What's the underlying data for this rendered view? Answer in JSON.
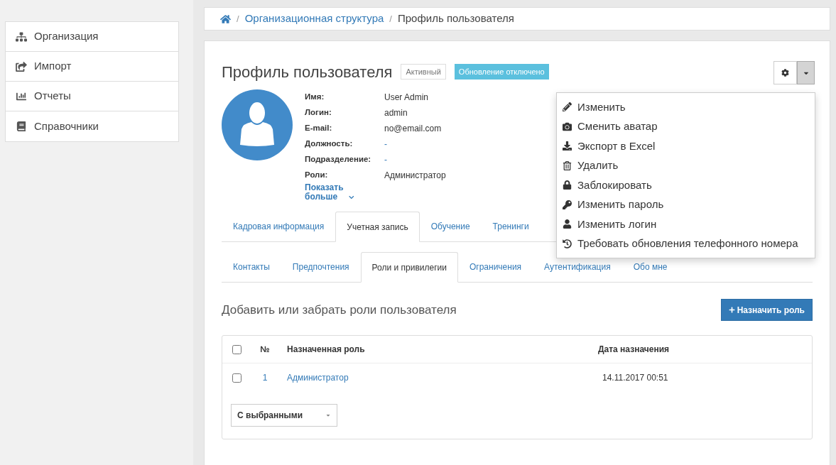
{
  "sidebar": {
    "items": [
      {
        "label": "Организация",
        "kind": "org"
      },
      {
        "label": "Импорт",
        "kind": "import"
      },
      {
        "label": "Отчеты",
        "kind": "reports"
      },
      {
        "label": "Справочники",
        "kind": "book"
      }
    ]
  },
  "breadcrumb": [
    {
      "label": "Организационная структура",
      "kind": "link",
      "separator": "/"
    },
    {
      "label": "Профиль пользователя",
      "kind": "current",
      "separator": "/"
    }
  ],
  "profile": {
    "title": "Профиль пользователя",
    "badges": [
      {
        "label": "Активный",
        "kind": "outline"
      },
      {
        "label": "Обновление отключено",
        "kind": "info"
      }
    ],
    "fields": [
      {
        "label": "Имя:",
        "value": "User Admin",
        "kind": "text"
      },
      {
        "label": "Логин:",
        "value": "admin",
        "kind": "text"
      },
      {
        "label": "E-mail:",
        "value": "no@email.com",
        "kind": "text"
      },
      {
        "label": "Должность:",
        "value": "-",
        "kind": "link"
      },
      {
        "label": "Подразделение:",
        "value": "-",
        "kind": "link"
      },
      {
        "label": "Роли:",
        "value": "Администратор",
        "kind": "text"
      }
    ],
    "show_more": "Показать больше"
  },
  "settings_menu": {
    "expanded": true,
    "items": [
      {
        "label": "Изменить",
        "kind": "edit"
      },
      {
        "label": "Сменить аватар",
        "kind": "camera"
      },
      {
        "label": "Экспорт в Excel",
        "kind": "download"
      },
      {
        "label": "Удалить",
        "kind": "trash"
      },
      {
        "label": "Заблокировать",
        "kind": "lock"
      },
      {
        "label": "Изменить пароль",
        "kind": "key"
      },
      {
        "label": "Изменить логин",
        "kind": "user"
      },
      {
        "label": "Требовать обновления телефонного номера",
        "kind": "history"
      }
    ]
  },
  "tabs": [
    {
      "label": "Кадровая информация",
      "selected": false
    },
    {
      "label": "Учетная запись",
      "selected": true
    },
    {
      "label": "Обучение",
      "selected": false
    },
    {
      "label": "Тренинги",
      "selected": false
    }
  ],
  "subtabs": [
    {
      "label": "Контакты",
      "selected": false
    },
    {
      "label": "Предпочтения",
      "selected": false
    },
    {
      "label": "Роли и привилегии",
      "selected": true
    },
    {
      "label": "Ограничения",
      "selected": false
    },
    {
      "label": "Аутентификация",
      "selected": false
    },
    {
      "label": "Обо мне",
      "selected": false
    }
  ],
  "roles": {
    "title": "Добавить или забрать роли пользователя",
    "assign_button": "Назначить роль",
    "table": {
      "select_all_checked": false,
      "columns": [
        "№",
        "Назначенная роль",
        "Дата назначения"
      ],
      "rows": [
        {
          "checked": false,
          "number": "1",
          "role": "Администратор",
          "date": "14.11.2017 00:51"
        }
      ]
    },
    "bulk_action": "С выбранными"
  }
}
